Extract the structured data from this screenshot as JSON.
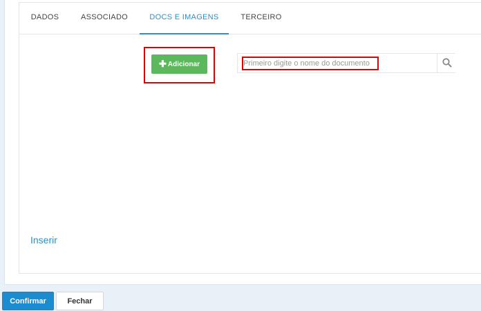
{
  "tabs": [
    {
      "label": "DADOS",
      "active": false
    },
    {
      "label": "ASSOCIADO",
      "active": false
    },
    {
      "label": "DOCS E IMAGENS",
      "active": true
    },
    {
      "label": "TERCEIRO",
      "active": false
    }
  ],
  "documents": {
    "add_button_label": "Adicionar",
    "add_button_icon": "plus-icon",
    "search_placeholder": "Primeiro digite o nome do documento",
    "search_value": "",
    "search_icon": "search-icon"
  },
  "inserir_label": "Inserir",
  "footer": {
    "confirm_label": "Confirmar",
    "close_label": "Fechar"
  },
  "colors": {
    "accent": "#2a8fc5",
    "add_button": "#5cb85c",
    "confirm_button": "#1a8ccf",
    "highlight": "#e00000"
  }
}
